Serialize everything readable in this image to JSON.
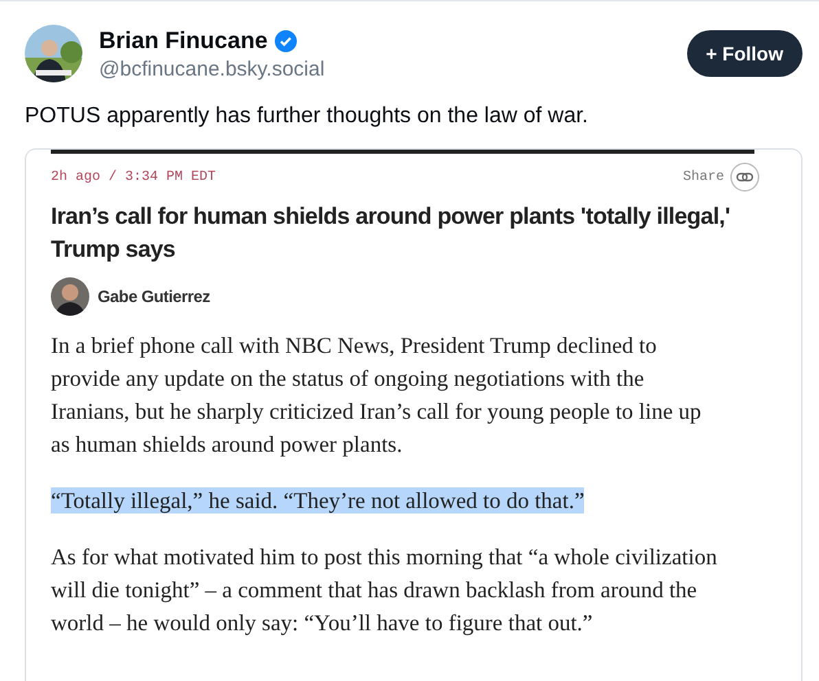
{
  "post": {
    "author_name": "Brian Finucane",
    "verified": true,
    "handle": "@bcfinucane.bsky.social",
    "follow_button": "+ Follow",
    "text": "POTUS apparently has further thoughts on the law of war."
  },
  "embed": {
    "timestamp": "2h ago / 3:34 PM EDT",
    "share_label": "Share",
    "headline": "Iran’s call for human shields around power plants 'totally illegal,' Trump says",
    "byline": "Gabe Gutierrez",
    "paragraphs": [
      {
        "text": "In a brief phone call with NBC News, President Trump declined to provide any update on the status of ongoing negotiations with the Iranians, but he sharply criticized Iran’s call for young people to line up as human shields around power plants.",
        "highlighted": false
      },
      {
        "text": "“Totally illegal,” he said. “They’re not allowed to do that.”",
        "highlighted": true
      },
      {
        "text": "As for what motivated him to post this morning that “a whole civilization will die tonight” – a comment that has drawn backlash from around the world – he would only say: “You’ll have to figure that out.”",
        "highlighted": false
      }
    ]
  }
}
